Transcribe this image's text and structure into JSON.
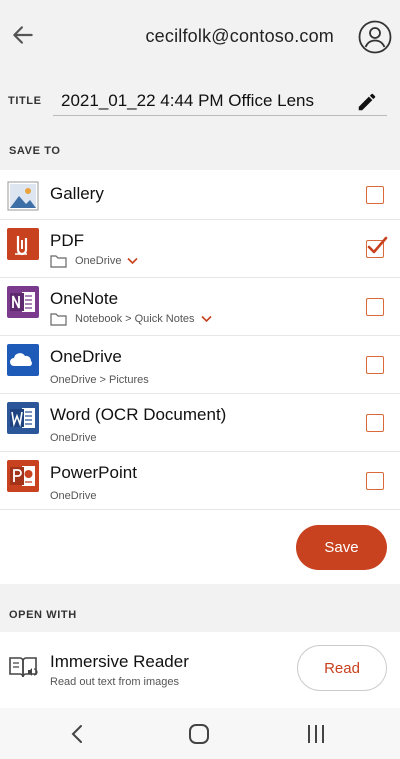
{
  "header": {
    "account_email": "cecilfolk@contoso.com"
  },
  "title_field": {
    "label": "TITLE",
    "value": "2021_01_22 4:44 PM Office Lens"
  },
  "save_to": {
    "section_label": "SAVE TO",
    "items": [
      {
        "title": "Gallery",
        "subtitle": "",
        "checked": false
      },
      {
        "title": "PDF",
        "subtitle": "OneDrive",
        "checked": true
      },
      {
        "title": "OneNote",
        "subtitle": "Notebook > Quick Notes",
        "checked": false
      },
      {
        "title": "OneDrive",
        "subtitle": "OneDrive > Pictures",
        "checked": false
      },
      {
        "title": "Word (OCR Document)",
        "subtitle": "OneDrive",
        "checked": false
      },
      {
        "title": "PowerPoint",
        "subtitle": "OneDrive",
        "checked": false
      }
    ],
    "save_label": "Save"
  },
  "open_with": {
    "section_label": "OPEN WITH",
    "reader_title": "Immersive Reader",
    "reader_subtitle": "Read out text from images",
    "read_label": "Read"
  },
  "colors": {
    "accent": "#c8421f",
    "header_bg": "#f2f2f2",
    "pdf": "#c8421f",
    "onenote": "#7b3b8c",
    "onedrive": "#1e5ab8",
    "word": "#2b579a",
    "powerpoint": "#c8421f"
  },
  "icons": {
    "back": "arrow-left-icon",
    "avatar": "user-circle-icon",
    "edit": "pencil-icon",
    "folder": "folder-icon",
    "dropdown": "chevron-down-icon",
    "checkmark": "checkmark-icon",
    "reader": "immersive-reader-icon"
  }
}
